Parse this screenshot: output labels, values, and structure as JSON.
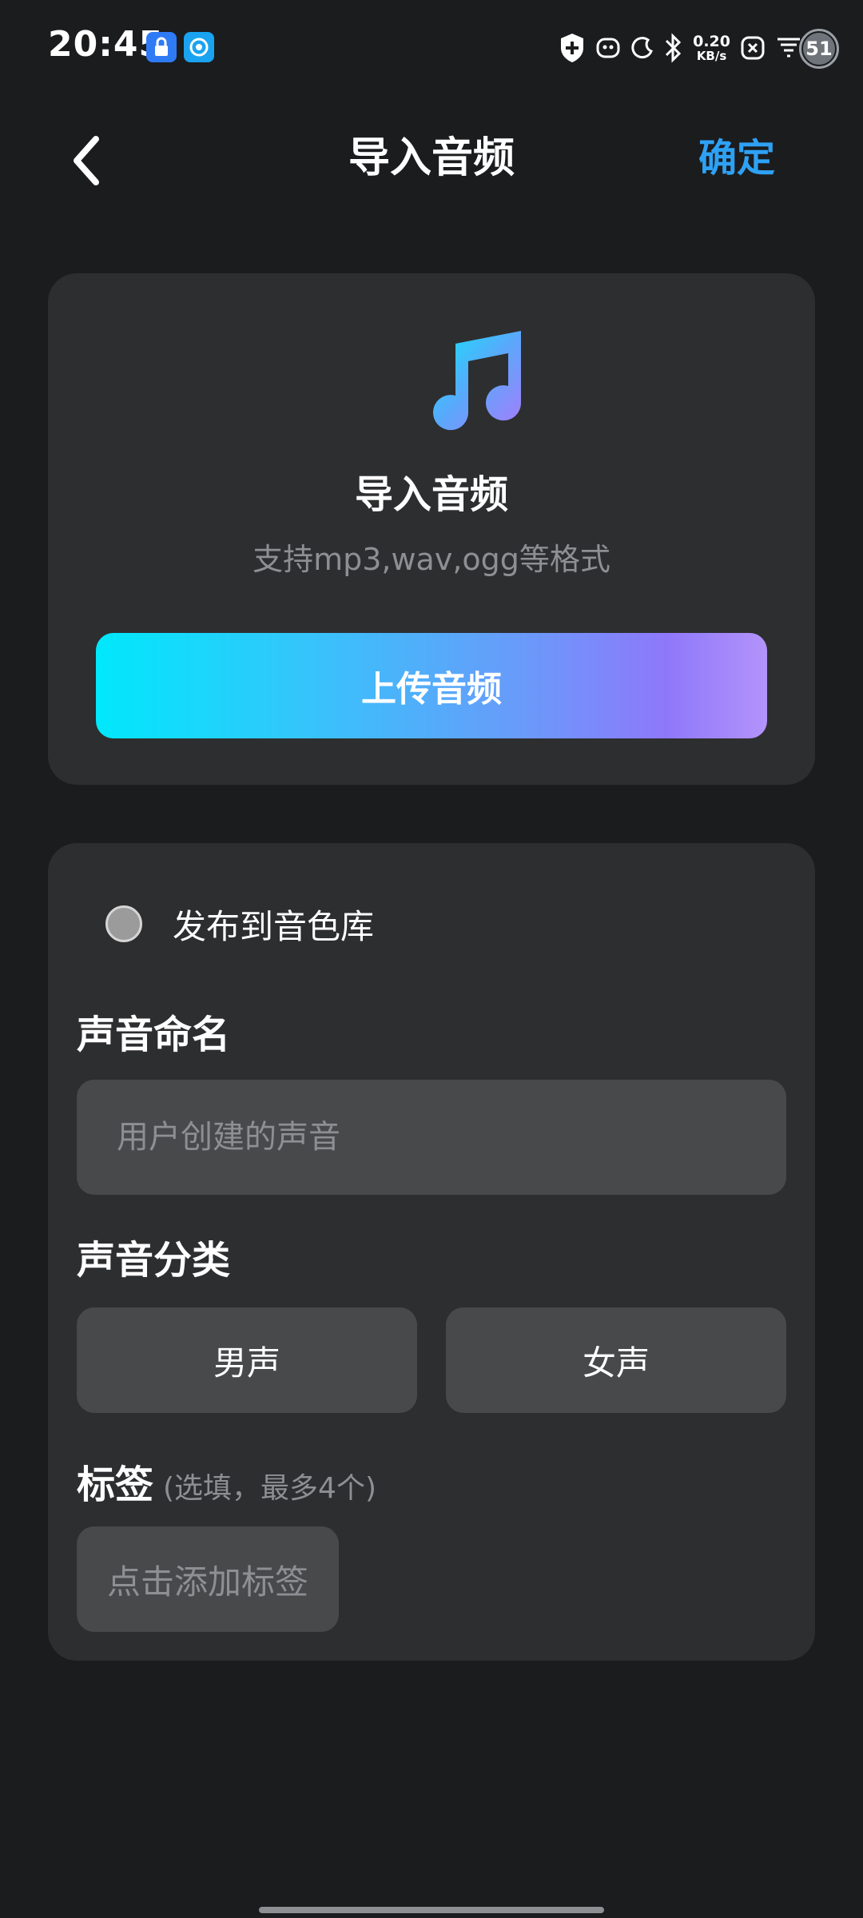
{
  "status_bar": {
    "time": "20:45",
    "net_speed_value": "0.20",
    "net_speed_unit": "KB/s",
    "battery_level": "51",
    "icons": [
      "lock-app-icon",
      "sync-app-icon",
      "shield-plus-icon",
      "face-icon",
      "moon-icon",
      "bluetooth-icon",
      "nfc-x-icon",
      "wifi-icon"
    ]
  },
  "top_bar": {
    "title": "导入音频",
    "confirm_label": "确定",
    "back_icon": "chevron-left-icon"
  },
  "upload_card": {
    "icon": "music-note-icon",
    "title": "导入音频",
    "subtitle": "支持mp3,wav,ogg等格式",
    "button_label": "上传音频"
  },
  "form": {
    "publish_label": "发布到音色库",
    "publish_checked": false,
    "name_label": "声音命名",
    "name_placeholder": "用户创建的声音",
    "name_value": "",
    "category_label": "声音分类",
    "categories": [
      "男声",
      "女声"
    ],
    "tags_label": "标签",
    "tags_hint": "(选填，最多4个)",
    "add_tag_label": "点击添加标签"
  },
  "colors": {
    "background": "#1b1c1e",
    "card": "#2d2e30",
    "field": "#48494b",
    "accent": "#2ea1f5",
    "gradient_start": "#00e8fb",
    "gradient_end": "#b393fb"
  }
}
